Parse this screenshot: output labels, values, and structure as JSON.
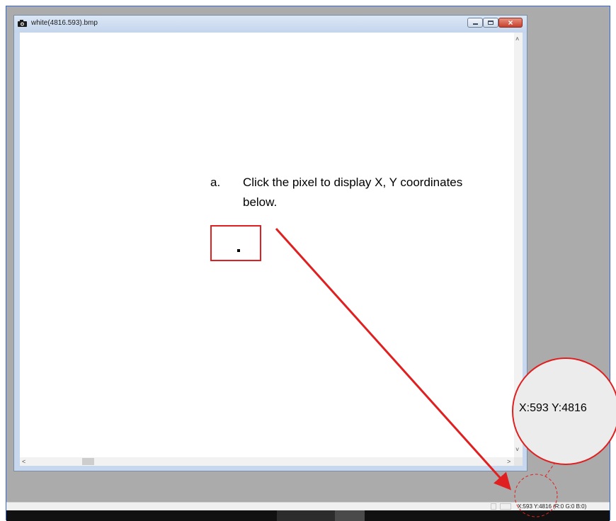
{
  "window": {
    "title": "white(4816.593).bmp",
    "icon": "camera-icon",
    "buttons": {
      "minimize": "minimize-icon",
      "maximize": "maximize-icon",
      "close": "×"
    }
  },
  "scroll": {
    "up": "˄",
    "down": "˅",
    "left": "<",
    "right": ">"
  },
  "instruction": {
    "marker": "a.",
    "text": "Click the pixel to display X, Y coordinates below."
  },
  "status": {
    "coordinates": "X:593 Y:4816 (R:0 G:0 B:0)"
  },
  "callout": {
    "zoom_text": "X:593 Y:4816"
  },
  "colors": {
    "annotation": "#e02020",
    "workspace": "#ababab",
    "frame_border": "#3a64c8"
  }
}
